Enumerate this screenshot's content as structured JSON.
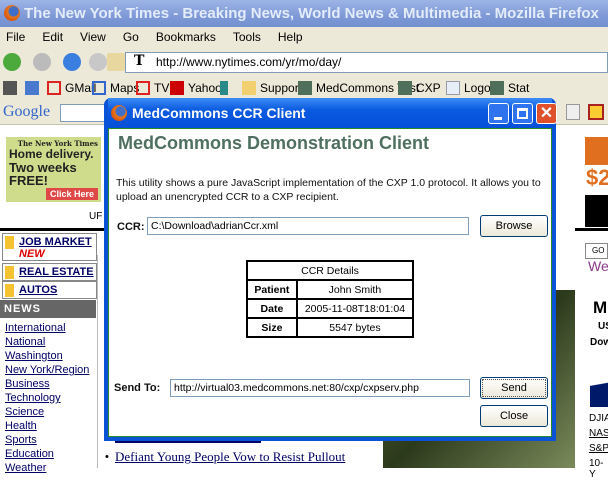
{
  "browser": {
    "title": "The New York Times - Breaking News, World News & Multimedia - Mozilla Firefox",
    "menu": [
      "File",
      "Edit",
      "View",
      "Go",
      "Bookmarks",
      "Tools",
      "Help"
    ],
    "url": "http://www.nytimes.com/yr/mo/day/",
    "bookmarks": [
      "GMail",
      "Maps",
      "TV",
      "Yahoo",
      "Support",
      "MedCommons Test",
      "CXP",
      "Logout",
      "Stat"
    ],
    "google": "Google"
  },
  "page": {
    "ad": {
      "brand": "The New York Times",
      "line1": "Home delivery.",
      "line2": "Two weeks",
      "line3": "FREE!",
      "cta": "Click Here"
    },
    "up_text": "UF",
    "nav": [
      {
        "label": "JOB MARKET",
        "badge": "NEW"
      },
      {
        "label": "REAL ESTATE"
      },
      {
        "label": "AUTOS"
      }
    ],
    "news_header": "NEWS",
    "sections": [
      "International",
      "National",
      "Washington",
      "New York/Region",
      "Business",
      "Technology",
      "Science",
      "Health",
      "Sports",
      "Education",
      "Weather"
    ],
    "headline": "Defiant Young People Vow to Resist Pullout",
    "right": {
      "price": "$2",
      "go": "GO",
      "we": "We",
      "m": "M",
      "us": "US",
      "dow": "Dow",
      "tickers": [
        "DJIA",
        "NAS",
        "S&P",
        "10-Y"
      ]
    }
  },
  "dialog": {
    "title": "MedCommons CCR Client",
    "heading": "MedCommons Demonstration Client",
    "description": "This utility shows a pure JavaScript implementation of the CXP 1.0 protocol. It allows you to upload an unencrypted CCR to a CXP recipient.",
    "ccr_label": "CCR:",
    "ccr_value": "C:\\Download\\adrianCcr.xml",
    "browse": "Browse",
    "details": {
      "caption": "CCR Details",
      "rows": [
        {
          "k": "Patient",
          "v": "John Smith"
        },
        {
          "k": "Date",
          "v": "2005-11-08T18:01:04"
        },
        {
          "k": "Size",
          "v": "5547 bytes"
        }
      ]
    },
    "sendto_label": "Send To:",
    "sendto_value": "http://virtual03.medcommons.net:80/cxp/cxpserv.php",
    "send": "Send",
    "close": "Close"
  }
}
